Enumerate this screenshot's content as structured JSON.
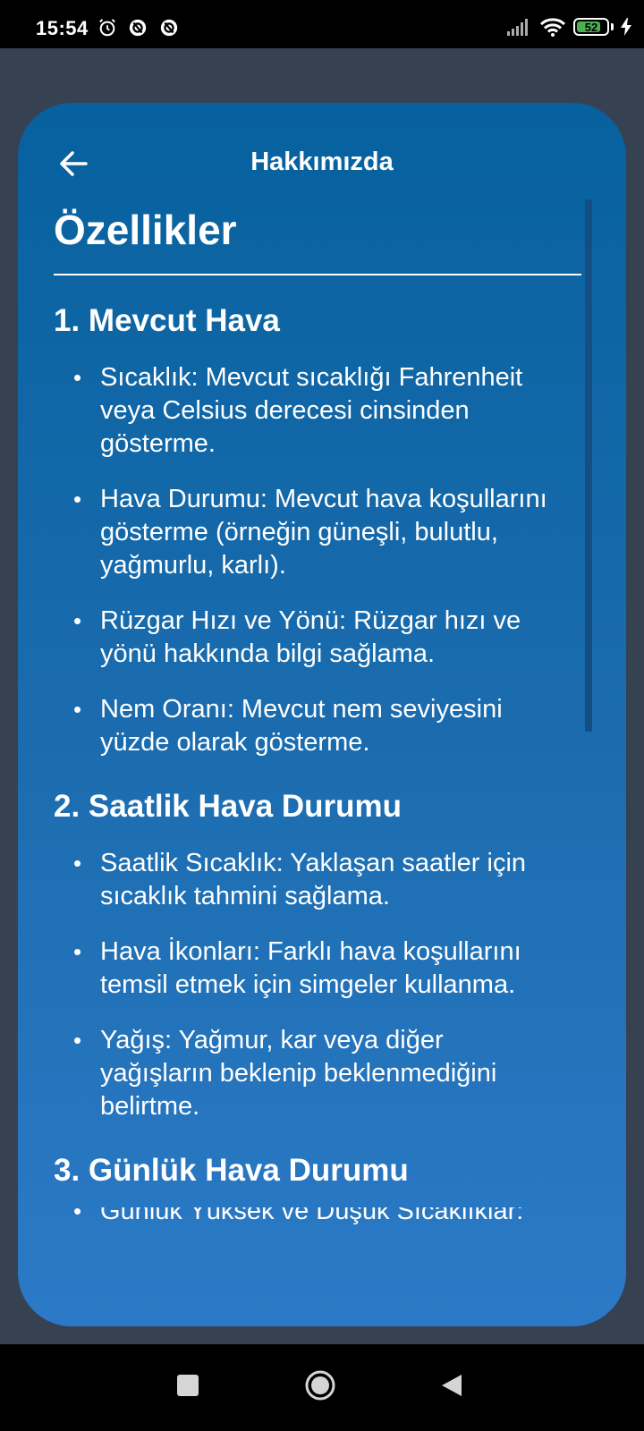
{
  "status_bar": {
    "time": "15:54",
    "battery_level": "52",
    "icons": [
      "alarm-icon",
      "notification-icon",
      "notification-icon",
      "signal-icon",
      "wifi-icon",
      "battery-icon",
      "charging-icon"
    ]
  },
  "header": {
    "title": "Hakkımızda",
    "back_icon": "arrow-left-icon"
  },
  "page": {
    "title": "Özellikler",
    "sections": [
      {
        "title": "1. Mevcut Hava",
        "items": [
          "Sıcaklık: Mevcut sıcaklığı Fahrenheit\nveya Celsius derecesi cinsinden\ngösterme.",
          "Hava Durumu: Mevcut hava koşullarını\ngösterme (örneğin güneşli, bulutlu,\nyağmurlu, karlı).",
          "Rüzgar Hızı ve Yönü: Rüzgar hızı ve\nyönü hakkında bilgi sağlama.",
          "Nem Oranı: Mevcut nem seviyesini\nyüzde olarak gösterme."
        ]
      },
      {
        "title": "2. Saatlik Hava Durumu",
        "items": [
          "Saatlik Sıcaklık: Yaklaşan saatler için\nsıcaklık tahmini sağlama.",
          "Hava İkonları: Farklı hava koşullarını\ntemsil etmek için simgeler kullanma.",
          "Yağış: Yağmur, kar veya diğer\nyağışların beklenip beklenmediğini\nbelirtme."
        ]
      },
      {
        "title": "3. Günlük Hava Durumu",
        "items": [
          "Günlük Yüksek ve Düşük Sıcaklıklar:"
        ]
      }
    ]
  },
  "colors": {
    "background": "#364152",
    "card_top": "#07619e",
    "card_bottom": "#2c7ac7",
    "battery_fill": "#4caf50"
  }
}
